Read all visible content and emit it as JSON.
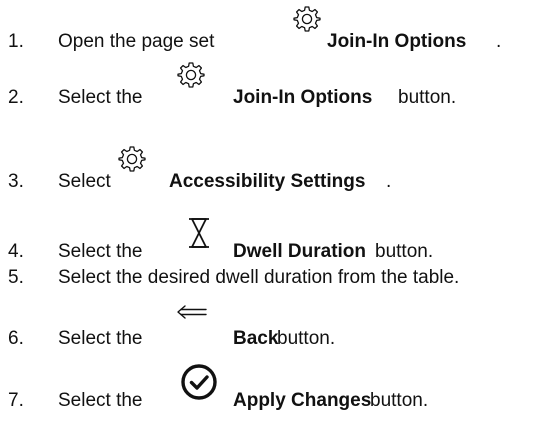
{
  "steps": [
    {
      "number": "1.",
      "text_before": "Open the page set",
      "icon": "gear-icon",
      "bold": "Join-In Options",
      "text_after": "."
    },
    {
      "number": "2.",
      "text_before": "Select the",
      "icon": "gear-icon",
      "bold": "Join-In Options",
      "text_after": " button."
    },
    {
      "number": "3.",
      "text_before": "Select",
      "icon": "gear-icon",
      "bold": "Accessibility Settings",
      "text_after": "."
    },
    {
      "number": "4.",
      "text_before": "Select the",
      "icon": "hourglass-icon",
      "bold": "Dwell Duration",
      "text_after": " button."
    },
    {
      "number": "5.",
      "text": "Select the desired dwell duration from the table."
    },
    {
      "number": "6.",
      "text_before": "Select the",
      "icon": "back-arrow-icon",
      "bold": "Back",
      "text_after": " button."
    },
    {
      "number": "7.",
      "text_before": "Select the",
      "icon": "check-circle-icon",
      "bold": "Apply Changes",
      "text_after": " button."
    }
  ],
  "colors": {
    "text": "#111111",
    "background": "#ffffff"
  }
}
